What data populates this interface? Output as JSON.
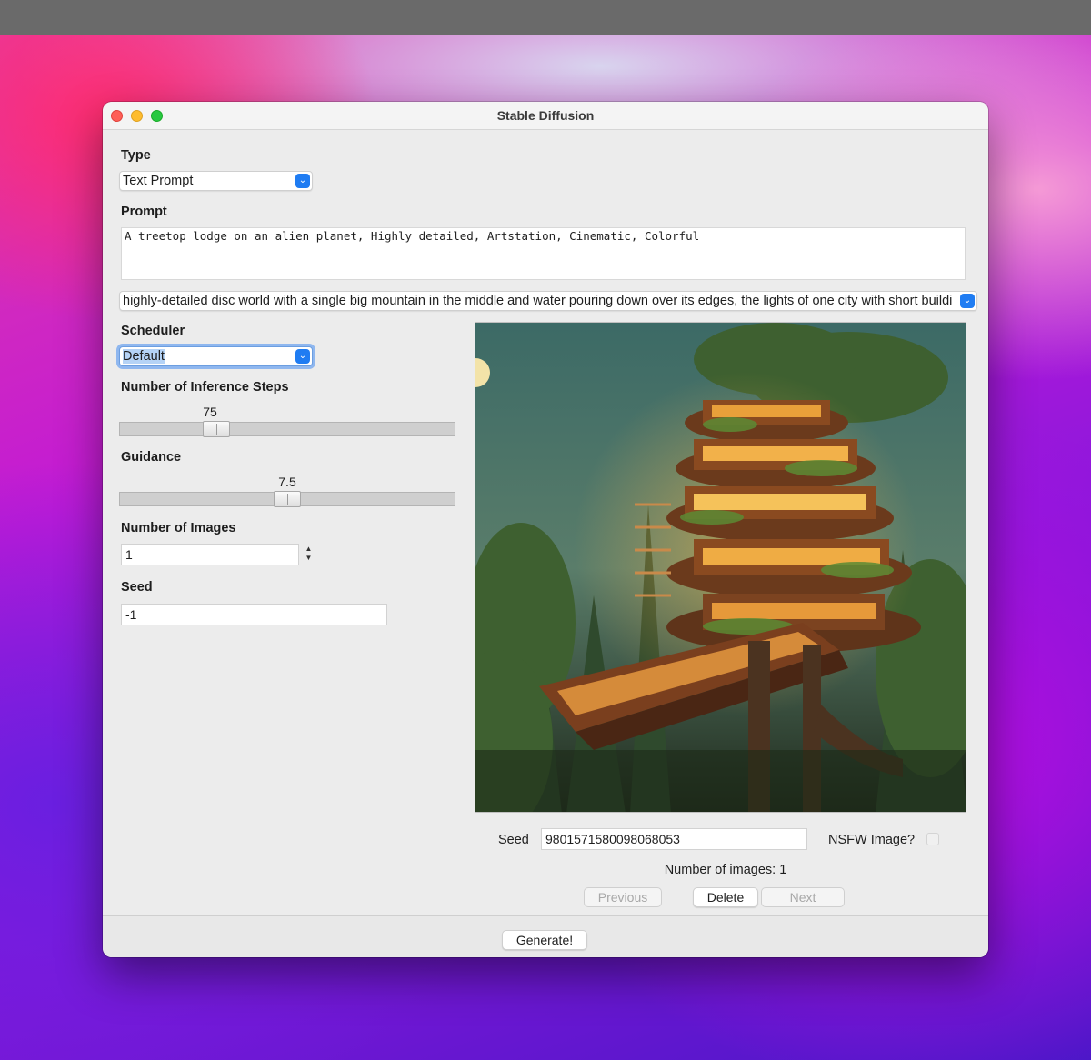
{
  "window": {
    "title": "Stable Diffusion"
  },
  "type": {
    "label": "Type",
    "value": "Text Prompt"
  },
  "prompt": {
    "label": "Prompt",
    "value": "A treetop lodge on an alien planet, Highly detailed, Artstation, Cinematic, Colorful"
  },
  "history": {
    "value": "highly-detailed disc world with a single big mountain in the middle and water pouring down over its edges, the lights of one city with short buildi"
  },
  "scheduler": {
    "label": "Scheduler",
    "value": "Default"
  },
  "steps": {
    "label": "Number of Inference Steps",
    "value": "75",
    "fraction": 0.27
  },
  "guidance": {
    "label": "Guidance",
    "value": "7.5",
    "fraction": 0.5
  },
  "num_images": {
    "label": "Number of Images",
    "value": "1"
  },
  "seed": {
    "label": "Seed",
    "value": "-1"
  },
  "result": {
    "seed_label": "Seed",
    "seed_value": "9801571580098068053",
    "nsfw_label": "NSFW Image?",
    "count_text": "Number of images: 1"
  },
  "buttons": {
    "previous": "Previous",
    "delete": "Delete",
    "next": "Next",
    "generate": "Generate!"
  },
  "colors": {
    "accent": "#1f7cf2",
    "window_bg": "#ececec"
  }
}
